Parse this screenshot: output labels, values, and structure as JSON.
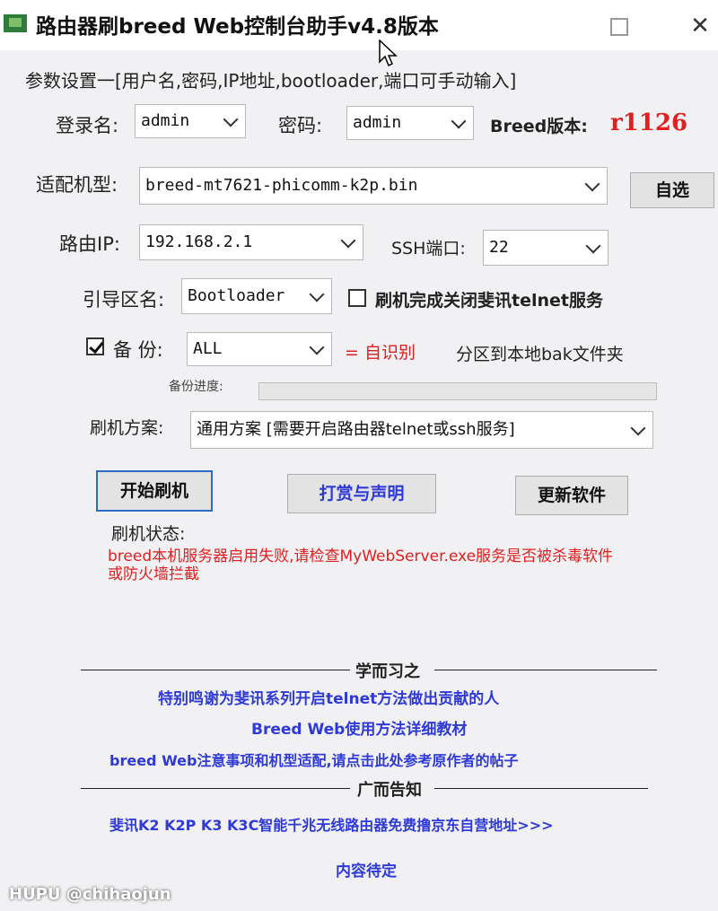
{
  "window": {
    "title": "路由器刷breed Web控制台助手v4.8版本"
  },
  "params": {
    "heading": "参数设置一[用户名,密码,IP地址,bootloader,端口可手动输入]",
    "login_label": "登录名:",
    "login_value": "admin",
    "password_label": "密码:",
    "password_value": "admin",
    "breed_version_label": "Breed版本:",
    "breed_version_value": "r1126",
    "model_label": "适配机型:",
    "model_value": "breed-mt7621-phicomm-k2p.bin",
    "custom_button": "自选",
    "ip_label": "路由IP:",
    "ip_value": "192.168.2.1",
    "ssh_port_label": "SSH端口:",
    "ssh_port_value": "22",
    "boot_label": "引导区名:",
    "boot_value": "Bootloader",
    "close_telnet_label": "刷机完成关闭斐讯telnet服务",
    "backup_label": "备 份:",
    "backup_value": "ALL",
    "auto_detect": "= 自识别",
    "backup_dest": "分区到本地bak文件夹",
    "progress_label": "备份进度:",
    "progress_value": 0,
    "scheme_label": "刷机方案:",
    "scheme_value": "通用方案 [需要开启路由器telnet或ssh服务]"
  },
  "actions": {
    "start_flash": "开始刷机",
    "reward": "打赏与声明",
    "update": "更新软件"
  },
  "status": {
    "label": "刷机状态:",
    "message": "breed本机服务器启用失败,请检查MyWebServer.exe服务是否被杀毒软件或防火墙拦截"
  },
  "learn": {
    "heading": "学而习之",
    "links": [
      "特别鸣谢为斐讯系列开启telnet方法做出贡献的人",
      "Breed Web使用方法详细教材",
      "breed Web注意事项和机型适配,请点击此处参考原作者的帖子"
    ]
  },
  "ads": {
    "heading": "广而告知",
    "links": [
      "斐讯K2 K2P K3 K3C智能千兆无线路由器免费撸京东自营地址>>>",
      "内容待定"
    ]
  },
  "watermark": "HUPU @chihaojun",
  "colors": {
    "accent_red": "#e02020",
    "link_blue": "#2f3ad6",
    "focus_blue": "#2b6cc4"
  }
}
